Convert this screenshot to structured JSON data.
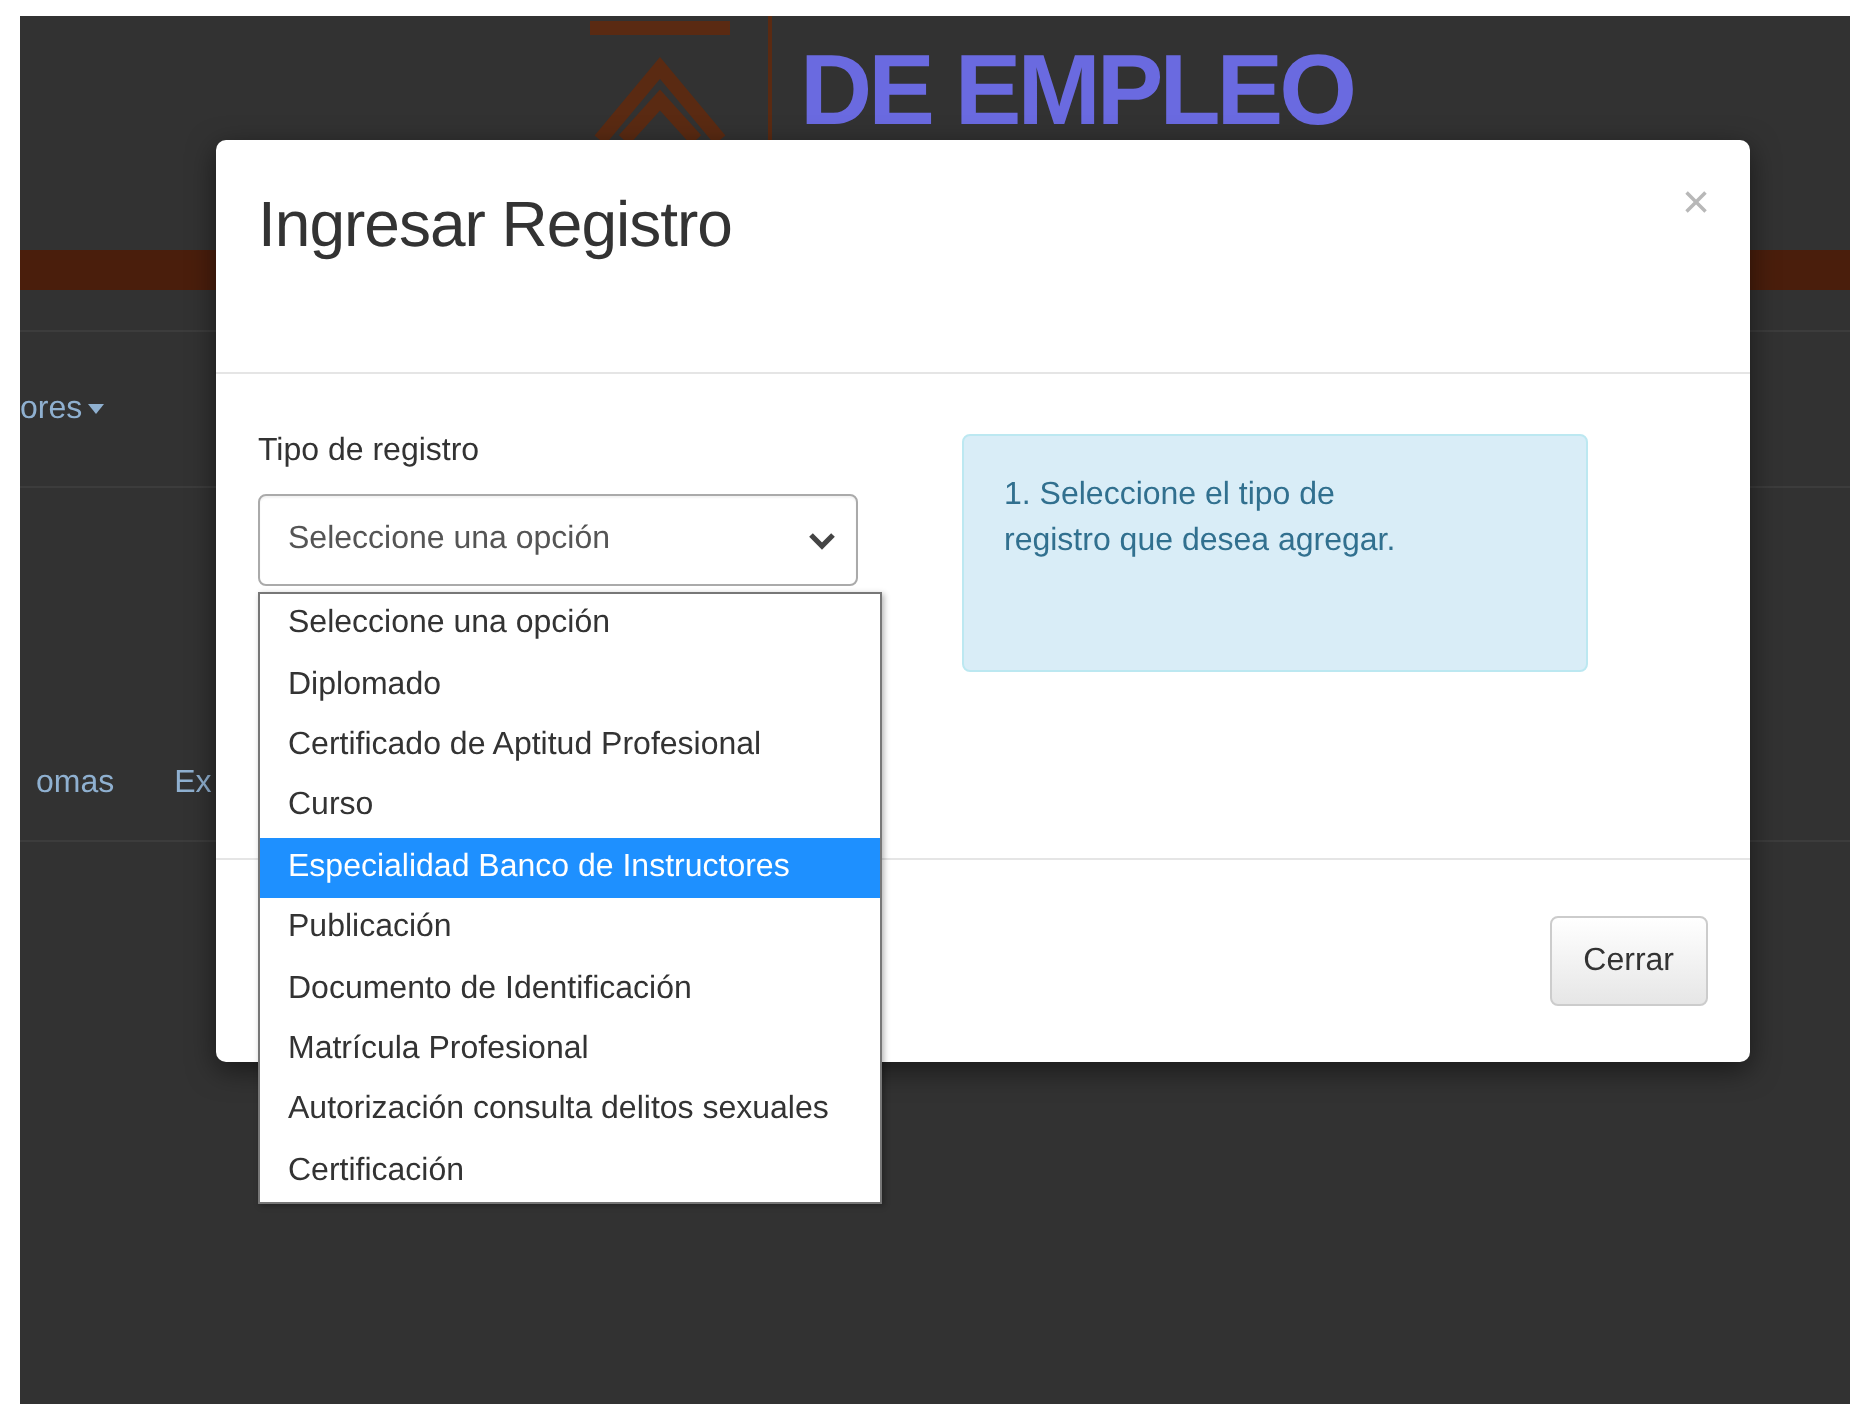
{
  "page": {
    "logo_text": "DE EMPLEO",
    "nav_item": "ores",
    "tabs": [
      "omas",
      "Ex"
    ]
  },
  "modal": {
    "title": "Ingresar Registro",
    "close": "×",
    "field_label": "Tipo de registro",
    "select": {
      "value": "Seleccione una opción",
      "expanded": true,
      "options": [
        {
          "label": "Seleccione una opción",
          "highlighted": false
        },
        {
          "label": "Diplomado",
          "highlighted": false
        },
        {
          "label": "Certificado de Aptitud Profesional",
          "highlighted": false
        },
        {
          "label": "Curso",
          "highlighted": false
        },
        {
          "label": "Especialidad Banco de Instructores",
          "highlighted": true
        },
        {
          "label": "Publicación",
          "highlighted": false
        },
        {
          "label": "Documento de Identificación",
          "highlighted": false
        },
        {
          "label": "Matrícula Profesional",
          "highlighted": false
        },
        {
          "label": "Autorización consulta delitos sexuales",
          "highlighted": false
        },
        {
          "label": "Certificación",
          "highlighted": false
        }
      ]
    },
    "info": "1. Seleccione el tipo de registro que desea agregar.",
    "buttons": [
      "Cerrar"
    ]
  }
}
